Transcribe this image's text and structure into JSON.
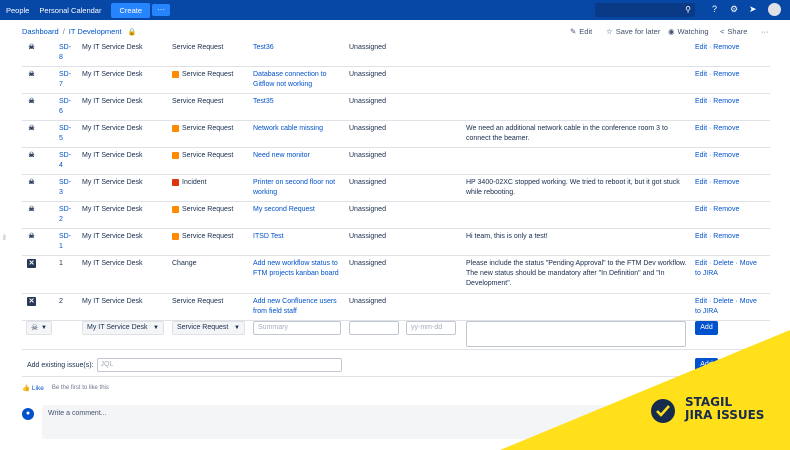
{
  "topnav": {
    "people": "People",
    "personal_calendar": "Personal Calendar",
    "create": "Create",
    "more": "···"
  },
  "breadcrumb": {
    "dashboard": "Dashboard",
    "separator": "/",
    "space": "IT Development"
  },
  "page_actions": {
    "edit": "Edit",
    "save_for_later": "Save for later",
    "watching": "Watching",
    "share": "Share",
    "more": "···"
  },
  "rows": [
    {
      "key": "SD-8",
      "project": "My IT Service Desk",
      "itype": "Service Request",
      "badge": "",
      "summary": "Test36",
      "assignee": "Unassigned",
      "desc": "",
      "actions": "Edit · Remove"
    },
    {
      "key": "SD-7",
      "project": "My IT Service Desk",
      "itype": "Service Request",
      "badge": "orange",
      "summary": "Database connection to Gitflow not working",
      "assignee": "Unassigned",
      "desc": "",
      "actions": "Edit · Remove"
    },
    {
      "key": "SD-6",
      "project": "My IT Service Desk",
      "itype": "Service Request",
      "badge": "",
      "summary": "Test35",
      "assignee": "Unassigned",
      "desc": "",
      "actions": "Edit · Remove"
    },
    {
      "key": "SD-5",
      "project": "My IT Service Desk",
      "itype": "Service Request",
      "badge": "orange",
      "summary": "Network cable missing",
      "assignee": "Unassigned",
      "desc": "We need an additional network cable in the conference room 3 to connect the beamer.",
      "actions": "Edit · Remove"
    },
    {
      "key": "SD-4",
      "project": "My IT Service Desk",
      "itype": "Service Request",
      "badge": "orange",
      "summary": "Need new monitor",
      "assignee": "Unassigned",
      "desc": "",
      "actions": "Edit · Remove"
    },
    {
      "key": "SD-3",
      "project": "My IT Service Desk",
      "itype": "Incident",
      "badge": "red",
      "summary": "Printer on second floor not working",
      "assignee": "Unassigned",
      "desc": "HP 3400-02XC stopped working. We tried to reboot it, but it got stuck while rebooting.",
      "actions": "Edit · Remove"
    },
    {
      "key": "SD-2",
      "project": "My IT Service Desk",
      "itype": "Service Request",
      "badge": "orange",
      "summary": "My second Request",
      "assignee": "Unassigned",
      "desc": "",
      "actions": "Edit · Remove"
    },
    {
      "key": "SD-1",
      "project": "My IT Service Desk",
      "itype": "Service Request",
      "badge": "orange",
      "summary": "ITSD Test",
      "assignee": "Unassigned",
      "desc": "Hi team, this is only a test!",
      "actions": "Edit · Remove"
    },
    {
      "key": "1",
      "project": "My IT Service Desk",
      "itype": "Change",
      "badge": "",
      "summary": "Add new workflow status to FTM projects kanban board",
      "assignee": "Unassigned",
      "desc": "Please include the status \"Pending Approval\" to the FTM Dev workflow. The new status should be mandatory after \"In Definition\" and \"In Development\".",
      "actions": "Edit · Delete · Move to JIRA"
    },
    {
      "key": "2",
      "project": "My IT Service Desk",
      "itype": "Service Request",
      "badge": "",
      "summary": "Add new Confluence users from field staff",
      "assignee": "Unassigned",
      "desc": "",
      "actions": "Edit · Delete · Move to JIRA"
    }
  ],
  "new_row": {
    "project": "My IT Service Desk",
    "itype": "Service Request",
    "summary_placeholder": "Summary",
    "date_placeholder": "yy-mm-dd",
    "add": "Add"
  },
  "add_existing": {
    "label": "Add existing issue(s):",
    "placeholder": "JQL",
    "add": "Add"
  },
  "like": {
    "like": "Like",
    "text": "Be the first to like this"
  },
  "comment": {
    "placeholder": "Write a comment..."
  },
  "promo": {
    "line1": "STAGIL",
    "line2": "JIRA ISSUES",
    "accent": "#ffe01b"
  }
}
